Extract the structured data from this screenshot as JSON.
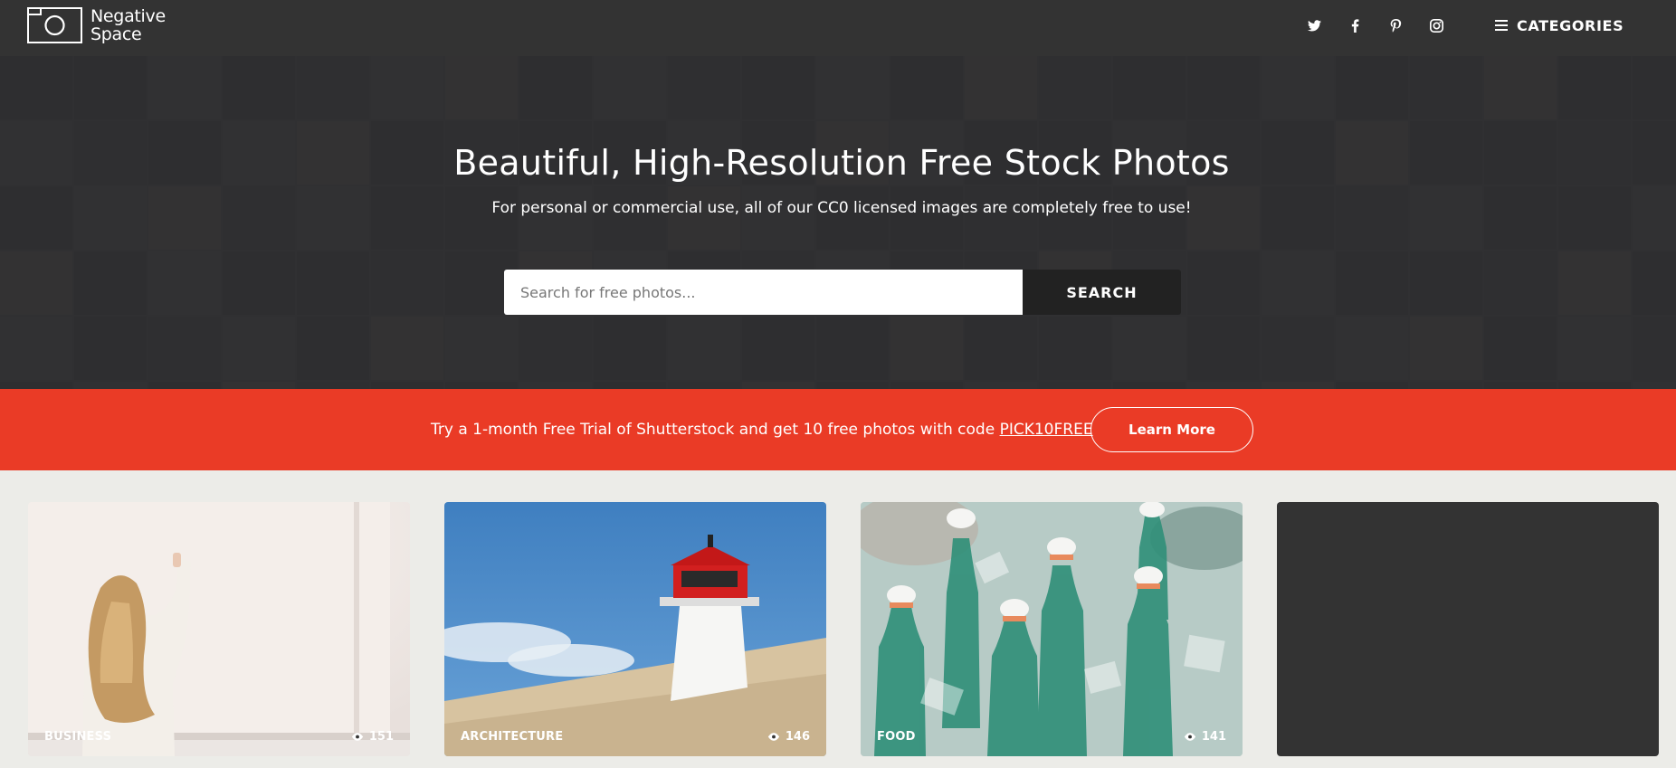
{
  "brand": {
    "line1": "Negative",
    "line2": "Space"
  },
  "header": {
    "socials": [
      "twitter-icon",
      "facebook-icon",
      "pinterest-icon",
      "instagram-icon"
    ],
    "categories_label": "CATEGORIES"
  },
  "hero": {
    "title": "Beautiful, High-Resolution Free Stock Photos",
    "subtitle": "For personal or commercial use, all of our CC0 licensed images are completely free to use!",
    "search_placeholder": "Search for free photos...",
    "search_button": "SEARCH"
  },
  "promo": {
    "text": "Try a 1-month Free Trial of Shutterstock and get 10 free photos with code ",
    "code": "PICK10FREE",
    "button": "Learn More"
  },
  "cards": [
    {
      "category": "BUSINESS",
      "views": "151"
    },
    {
      "category": "ARCHITECTURE",
      "views": "146"
    },
    {
      "category": "FOOD",
      "views": "141"
    },
    {
      "category": "",
      "views": ""
    }
  ],
  "colors": {
    "header": "#333333",
    "promo": "#ea3b26",
    "page": "#ecece8"
  }
}
